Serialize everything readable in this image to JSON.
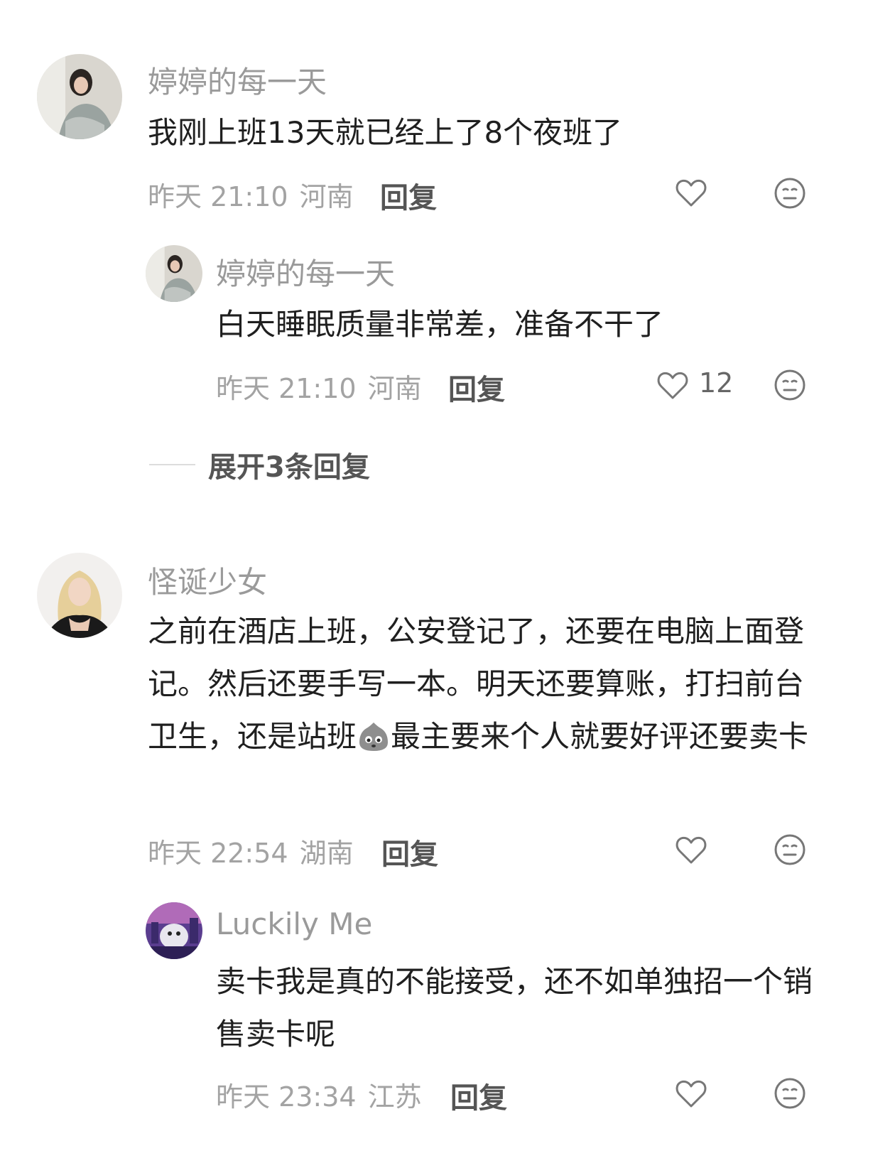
{
  "comments": [
    {
      "username": "婷婷的每一天",
      "text": "我刚上班13天就已经上了8个夜班了",
      "time": "昨天 21:10",
      "location": "河南",
      "reply_label": "回复",
      "likes": "",
      "replies": [
        {
          "username": "婷婷的每一天",
          "text": "白天睡眠质量非常差，准备不干了",
          "time": "昨天 21:10",
          "location": "河南",
          "reply_label": "回复",
          "likes": "12"
        }
      ],
      "expand_label": "展开3条回复"
    },
    {
      "username": "怪诞少女",
      "text_part1": "之前在酒店上班，公安登记了，还要在电脑上面登记。然后还要手写一本。明天还要算账，打扫前台卫生，还是站班",
      "text_part2": "最主要来个人就要好评还要卖卡",
      "time": "昨天 22:54",
      "location": "湖南",
      "reply_label": "回复",
      "likes": "",
      "replies": [
        {
          "username": "Luckily Me",
          "text": "卖卡我是真的不能接受，还不如单独招一个销售卖卡呢",
          "time": "昨天 23:34",
          "location": "江苏",
          "reply_label": "回复",
          "likes": ""
        }
      ]
    }
  ],
  "icons": {
    "like": "heart-outline-icon",
    "dislike": "meh-face-icon",
    "inline_emoji": "cry-face-emoji"
  }
}
